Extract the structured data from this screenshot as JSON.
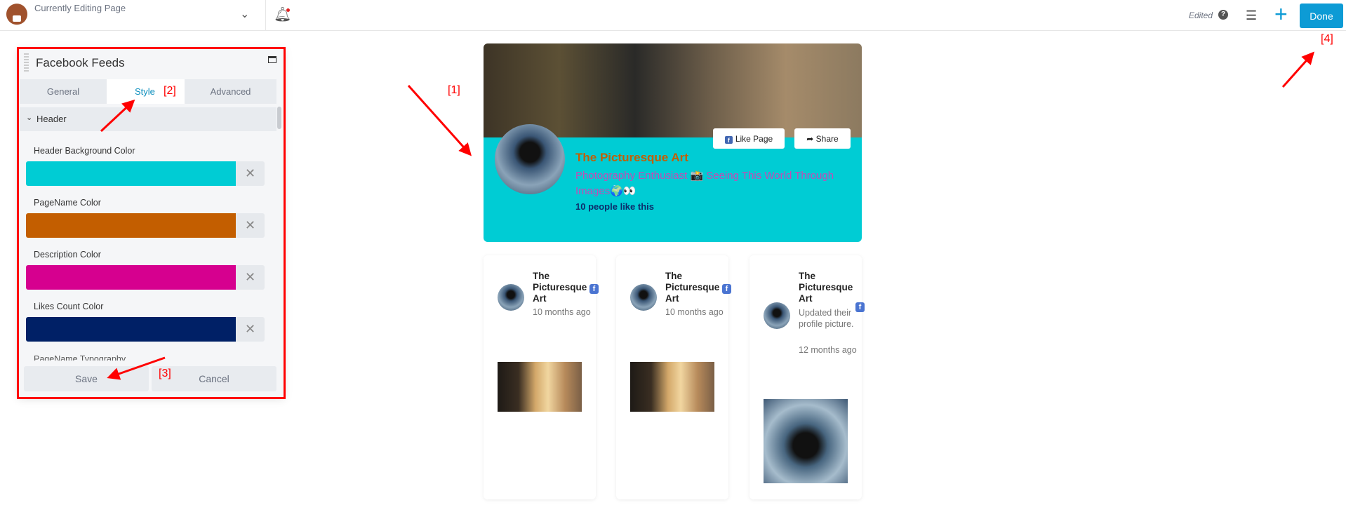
{
  "topbar": {
    "title": "Currently Editing Page",
    "status": "Edited",
    "done_label": "Done"
  },
  "panel": {
    "title": "Facebook Feeds",
    "tabs": [
      {
        "label": "General"
      },
      {
        "label": "Style"
      },
      {
        "label": "Advanced"
      }
    ],
    "active_tab": "Style",
    "section": "Header",
    "fields": [
      {
        "label": "Header Background Color",
        "color": "#00ccd4"
      },
      {
        "label": "PageName Color",
        "color": "#c35e00"
      },
      {
        "label": "Description Color",
        "color": "#d6008f"
      },
      {
        "label": "Likes Count Color",
        "color": "#002066"
      }
    ],
    "next_field": "PageName Typography",
    "save_label": "Save",
    "cancel_label": "Cancel"
  },
  "header_card": {
    "page_name": "The Picturesque Art",
    "description": "Photography Enthusiast 📸 Seeing This World Through Images🌍👀",
    "likes": "10 people like this",
    "like_label": "Like Page",
    "share_label": "Share"
  },
  "posts": [
    {
      "author": "The Picturesque Art",
      "time": "10 months ago"
    },
    {
      "author": "The Picturesque Art",
      "time": "10 months ago"
    },
    {
      "author": "The Picturesque Art",
      "text": "Updated their profile picture.",
      "time": "12 months ago"
    }
  ],
  "annotations": [
    "[1]",
    "[2]",
    "[3]",
    "[4]"
  ]
}
